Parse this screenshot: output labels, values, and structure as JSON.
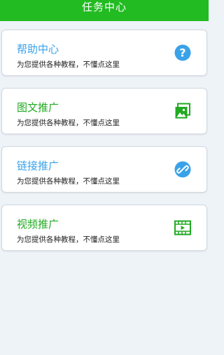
{
  "header": {
    "title": "任务中心"
  },
  "cards": [
    {
      "title": "帮助中心",
      "subtitle": "为您提供各种教程，不懂点这里",
      "title_color": "#3aa2e8",
      "icon": "help-icon",
      "icon_color": "#3aa2e8"
    },
    {
      "title": "图文推广",
      "subtitle": "为您提供各种教程，不懂点这里",
      "title_color": "#22aa22",
      "icon": "gallery-icon",
      "icon_color": "#22aa22"
    },
    {
      "title": "链接推广",
      "subtitle": "为您提供各种教程，不懂点这里",
      "title_color": "#3aa2e8",
      "icon": "link-icon",
      "icon_color": "#3aa2e8"
    },
    {
      "title": "视频推广",
      "subtitle": "为您提供各种教程，不懂点这里",
      "title_color": "#22aa22",
      "icon": "video-icon",
      "icon_color": "#22aa22"
    }
  ]
}
